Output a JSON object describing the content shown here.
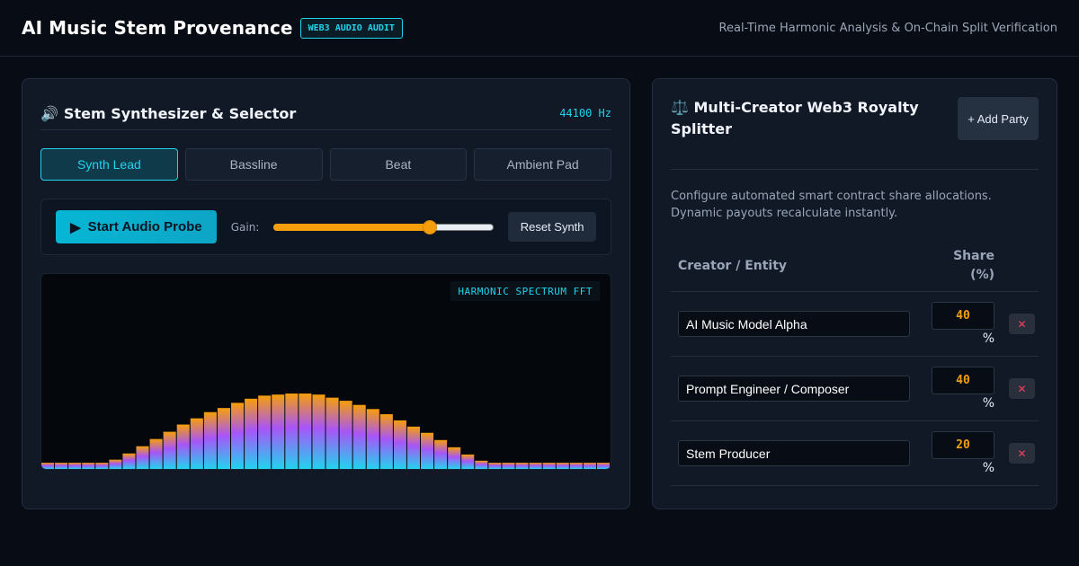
{
  "header": {
    "title": "AI Music Stem Provenance",
    "badge": "WEB3 AUDIO AUDIT",
    "subtitle": "Real-Time Harmonic Analysis & On-Chain Split Verification"
  },
  "synth": {
    "icon": "speaker-icon",
    "title": "Stem Synthesizer & Selector",
    "sample_rate": "44100 Hz",
    "tabs": [
      {
        "label": "Synth Lead",
        "active": true
      },
      {
        "label": "Bassline",
        "active": false
      },
      {
        "label": "Beat",
        "active": false
      },
      {
        "label": "Ambient Pad",
        "active": false
      }
    ],
    "start_label": "Start Audio Probe",
    "gain_label": "Gain:",
    "gain_value": 0.7,
    "reset_label": "Reset Synth",
    "spectrum_label": "HARMONIC SPECTRUM FFT",
    "spectrum_values": [
      0.06,
      0.06,
      0.06,
      0.06,
      0.06,
      0.09,
      0.15,
      0.22,
      0.29,
      0.36,
      0.43,
      0.49,
      0.55,
      0.59,
      0.64,
      0.68,
      0.71,
      0.72,
      0.73,
      0.73,
      0.72,
      0.69,
      0.66,
      0.62,
      0.58,
      0.53,
      0.47,
      0.41,
      0.35,
      0.28,
      0.21,
      0.14,
      0.08,
      0.06,
      0.06,
      0.06,
      0.06,
      0.06,
      0.06,
      0.06,
      0.06,
      0.06
    ],
    "colors": {
      "bar_top": "#f59e0b",
      "bar_mid": "#a855f7",
      "bar_bottom": "#22d3ee"
    }
  },
  "splitter": {
    "icon": "scales-icon",
    "title": "Multi-Creator Web3 Royalty Splitter",
    "add_label": "+ Add Party",
    "description": "Configure automated smart contract share allocations. Dynamic payouts recalculate instantly.",
    "col_creator": "Creator / Entity",
    "col_share": "Share (%)",
    "parties": [
      {
        "name": "AI Music Model Alpha",
        "share": "40",
        "unit": "%"
      },
      {
        "name": "Prompt Engineer / Composer",
        "share": "40",
        "unit": "%"
      },
      {
        "name": "Stem Producer",
        "share": "20",
        "unit": "%"
      }
    ],
    "delete_glyph": "✕"
  }
}
